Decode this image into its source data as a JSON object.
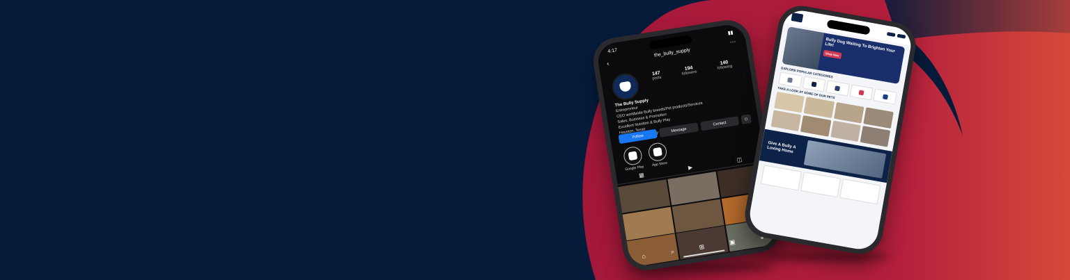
{
  "colors": {
    "background": "#061b3a",
    "accent_red": "#a3173a",
    "accent_orange": "#d7493a",
    "brand_navy": "#0d2247",
    "follow_blue": "#1877f2"
  },
  "instagram_phone": {
    "time": "4:17",
    "username": "the_bully_supply",
    "stats": [
      {
        "value": "147",
        "label": "posts"
      },
      {
        "value": "194",
        "label": "followers"
      },
      {
        "value": "140",
        "label": "following"
      }
    ],
    "bio": {
      "name": "The Bully Supply",
      "lines": [
        "Entrepreneur",
        "CEO worldwide Bully breeds/Pet products/Services",
        "Sales, Business & Promotion",
        "Excellent Nutrition & Bully Play",
        "Houston, Texas"
      ],
      "link": "linktr.ee/thebullysupply"
    },
    "buttons": {
      "follow": "Follow",
      "message": "Message",
      "contact": "Contact"
    },
    "highlights": [
      {
        "label": "Google Play"
      },
      {
        "label": "App Store"
      }
    ],
    "nav_icons": [
      "home-icon",
      "search-icon",
      "add-post-icon",
      "reels-icon",
      "profile-icon"
    ]
  },
  "website_phone": {
    "hero_title": "Bully Dog Waiting To Brighten Your Life!",
    "hero_cta": "Shop Now",
    "categories_title": "EXPLORE POPULAR CATEGORIES",
    "pets_title": "TAKE A LOOK AT SOME OF OUR PETS",
    "banner_title": "Give A Bully A Loving Home"
  }
}
